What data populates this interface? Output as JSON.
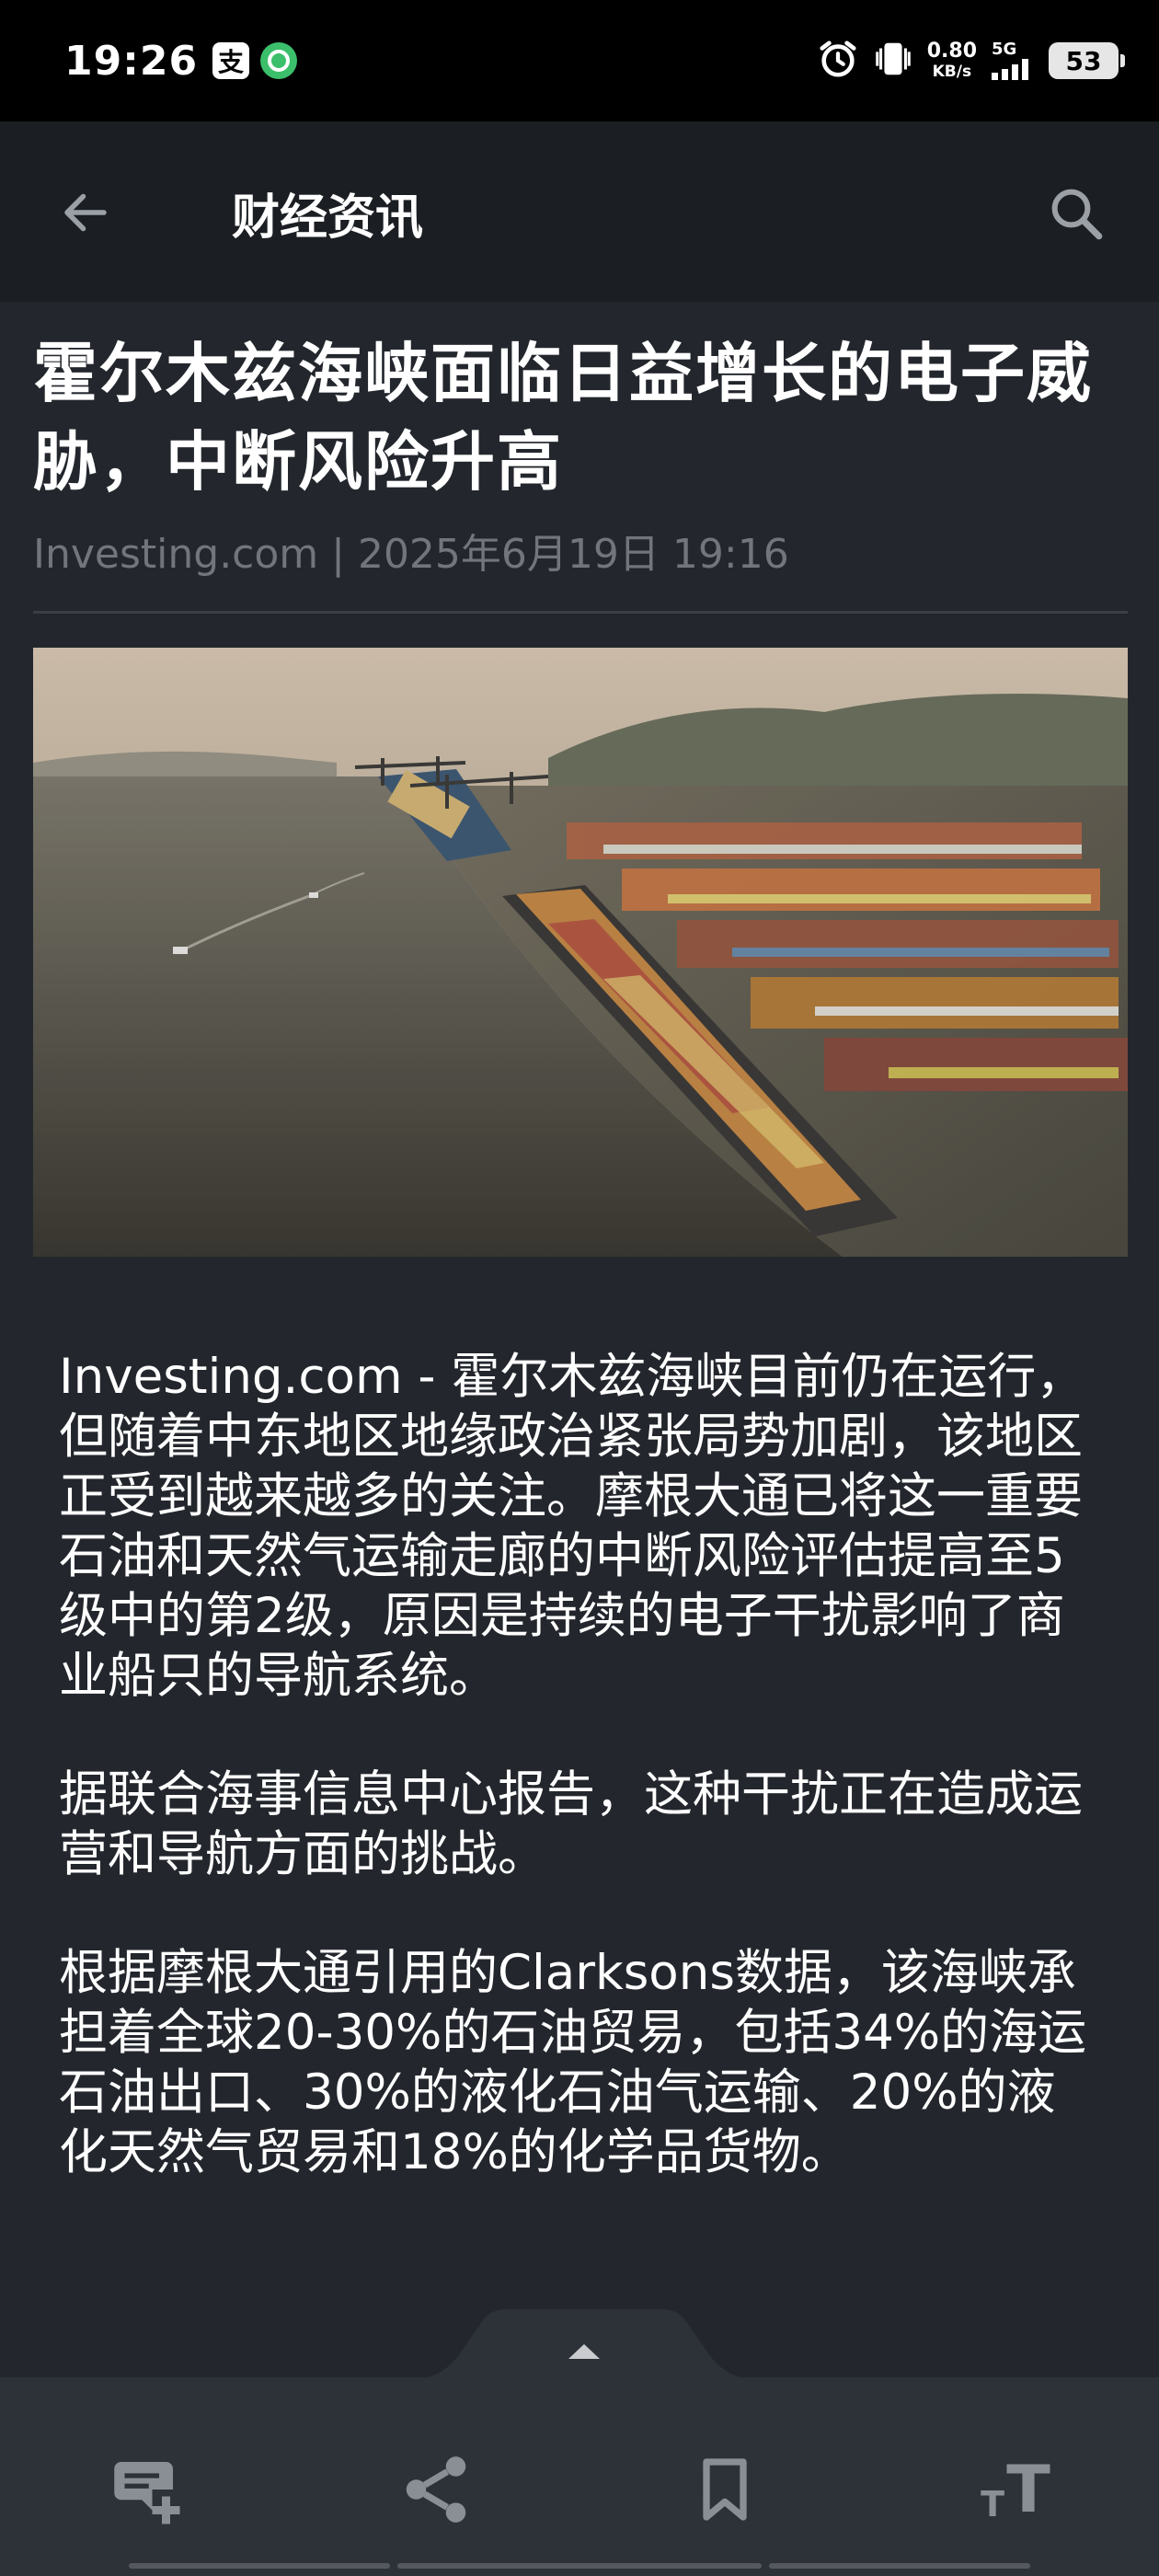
{
  "status_bar": {
    "time": "19:26",
    "app_icon_glyph": "支",
    "net_speed_value": "0.80",
    "net_speed_unit": "KB/s",
    "network": "5G",
    "battery": "53"
  },
  "app_bar": {
    "title": "财经资讯",
    "icons": {
      "back": "back-arrow-icon",
      "search": "search-icon"
    }
  },
  "article": {
    "title": "霍尔木兹海峡面临日益增长的电子威胁，中断风险升高",
    "meta": "Investing.com | 2025年6月19日 19:16",
    "paragraphs": [
      "Investing.com - 霍尔木兹海峡目前仍在运行，但随着中东地区地缘政治紧张局势加剧，该地区正受到越来越多的关注。摩根大通已将这一重要石油和天然气运输走廊的中断风险评估提高至5级中的第2级，原因是持续的电子干扰影响了商业船只的导航系统。",
      "据联合海事信息中心报告，这种干扰正在造成运营和导航方面的挑战。",
      "根据摩根大通引用的Clarksons数据，该海峡承担着全球20-30%的石油贸易，包括34%的海运石油出口、30%的液化石油气运输、20%的液化天然气贸易和18%的化学品货物。"
    ]
  },
  "bottom_bar": {
    "icons": [
      "add-comment-icon",
      "share-icon",
      "bookmark-icon",
      "text-size-icon"
    ],
    "text_size_small": "T",
    "text_size_big": "T"
  }
}
